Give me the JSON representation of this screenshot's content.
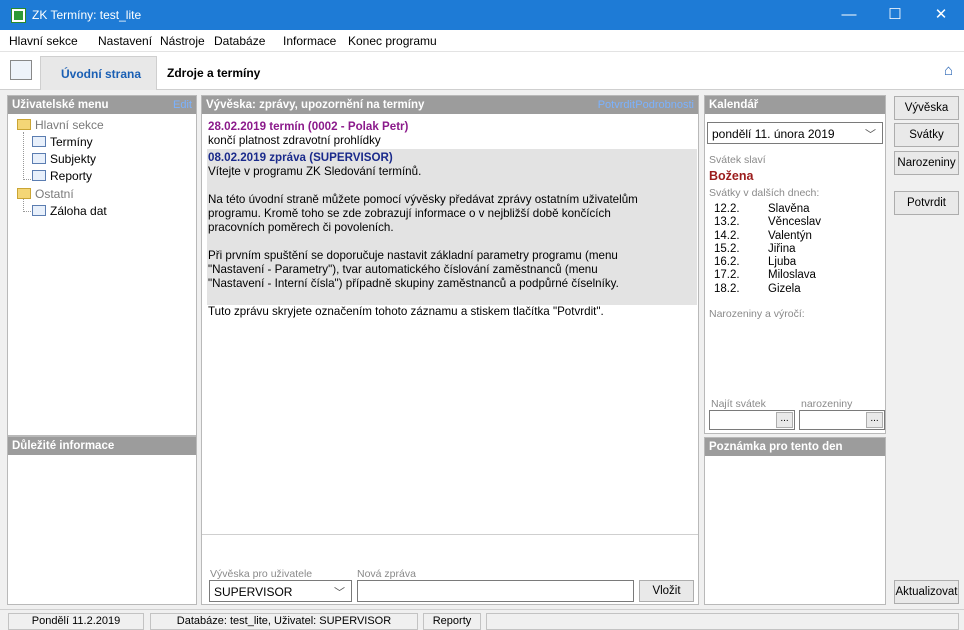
{
  "window": {
    "title": "ZK Termíny: test_lite",
    "minimize": "—",
    "maximize": "☐",
    "close": "✕"
  },
  "menu": {
    "items": [
      "Hlavní sekce",
      "Nastavení",
      "Nástroje",
      "Databáze",
      "Informace",
      "Konec programu"
    ]
  },
  "tabs": {
    "active": "Úvodní strana",
    "second": "Zdroje a termíny",
    "home_icon": "home-icon"
  },
  "user_menu": {
    "title": "Uživatelské menu",
    "edit": "Edit",
    "tree": {
      "group1": "Hlavní sekce",
      "items1": [
        "Termíny",
        "Subjekty",
        "Reporty"
      ],
      "group2": "Ostatní",
      "items2": [
        "Záloha dat"
      ]
    }
  },
  "important": {
    "title": "Důležité informace"
  },
  "board": {
    "title": "Vývěska: zprávy, upozornění na termíny",
    "confirm": "Potvrdit",
    "details": "Podrobnosti",
    "msg1_header": "28.02.2019 termín (0002 - Polak Petr)",
    "msg1_body": "končí platnost zdravotní prohlídky",
    "msg2_header": "08.02.2019 zpráva (SUPERVISOR)",
    "msg2_lines": [
      "Vítejte v programu ZK Sledování termínů.",
      "",
      "Na této úvodní straně můžete pomocí vývěsky předávat zprávy ostatním uživatelům",
      "programu. Kromě toho se zde zobrazují informace o v nejbližší době končících",
      "pracovních poměrech či povoleních.",
      "",
      "Při prvním spuštění se doporučuje nastavit základní parametry programu (menu",
      "\"Nastavení - Parametry\"), tvar automatického číslování zaměstnanců  (menu",
      "\"Nastavení - Interní čísla\") případně skupiny zaměstnanců a podpůrné číselníky.",
      "",
      "Tuto zprávu skryjete označením tohoto záznamu a stiskem tlačítka \"Potvrdit\"."
    ],
    "for_user_label": "Vývěska pro uživatele",
    "for_user_value": "SUPERVISOR",
    "new_msg_label": "Nová zpráva",
    "new_msg_value": "",
    "insert_button": "Vložit"
  },
  "calendar": {
    "title": "Kalendář",
    "date_value": "pondělí 11.  února  2019",
    "nameday_label": "Svátek slaví",
    "nameday_name": "Božena",
    "next_days_label": "Svátky v dalších dnech:",
    "next_days": [
      {
        "date": "12.2.",
        "name": "Slavěna"
      },
      {
        "date": "13.2.",
        "name": "Věnceslav"
      },
      {
        "date": "14.2.",
        "name": "Valentýn"
      },
      {
        "date": "15.2.",
        "name": "Jiřina"
      },
      {
        "date": "16.2.",
        "name": "Ljuba"
      },
      {
        "date": "17.2.",
        "name": "Miloslava"
      },
      {
        "date": "18.2.",
        "name": "Gizela"
      }
    ],
    "birthdays_label": "Narozeniny a výročí:",
    "find_nameday_label": "Najít svátek",
    "find_birthday_label": "narozeniny",
    "ellipsis": "...",
    "note_title": "Poznámka pro tento den"
  },
  "side_buttons": {
    "board": "Vývěska",
    "holidays": "Svátky",
    "birthdays": "Narozeniny",
    "confirm": "Potvrdit",
    "refresh": "Aktualizovat"
  },
  "status": {
    "date": "Pondělí 11.2.2019",
    "db": "Databáze: test_lite, Uživatel: SUPERVISOR",
    "section": "Reporty"
  },
  "colors": {
    "titlebar": "#1e7bd6",
    "panel_header": "#9c9c9c",
    "msg1": "#8b1a8b",
    "msg2": "#1a2a8b",
    "nameday": "#9b1c1c"
  }
}
